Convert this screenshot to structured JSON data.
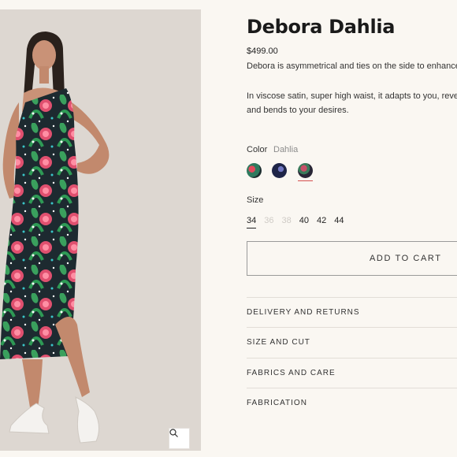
{
  "product": {
    "title": "Debora Dahlia",
    "price": "$499.00",
    "description_line1": "Debora is asymmetrical and ties on the side to enhance",
    "description_line2": "In viscose satin, super high waist, it adapts to you, revea",
    "description_line3": "and bends to your desires."
  },
  "color": {
    "label": "Color",
    "selected": "Dahlia",
    "swatches": [
      {
        "name": "swatch-1",
        "colors": [
          "#2e6e58",
          "#c23a4f"
        ]
      },
      {
        "name": "swatch-2",
        "colors": [
          "#1d2342",
          "#6a6fb0"
        ]
      },
      {
        "name": "swatch-3",
        "colors": [
          "#2c2a3a",
          "#b8536a"
        ]
      }
    ]
  },
  "size": {
    "label": "Size",
    "options": [
      {
        "label": "34",
        "available": true,
        "selected": true
      },
      {
        "label": "36",
        "available": false,
        "selected": false
      },
      {
        "label": "38",
        "available": false,
        "selected": false
      },
      {
        "label": "40",
        "available": true,
        "selected": false
      },
      {
        "label": "42",
        "available": true,
        "selected": false
      },
      {
        "label": "44",
        "available": true,
        "selected": false
      }
    ]
  },
  "cart": {
    "label": "ADD TO CART"
  },
  "accordion": [
    {
      "label": "DELIVERY AND RETURNS"
    },
    {
      "label": "SIZE AND CUT"
    },
    {
      "label": "FABRICS AND CARE"
    },
    {
      "label": "FABRICATION"
    }
  ],
  "icons": {
    "zoom": "zoom-icon"
  },
  "colors": {
    "background": "#faf7f2",
    "photo_bg": "#ddd7d1",
    "selected_underline": "#d54f4f"
  }
}
